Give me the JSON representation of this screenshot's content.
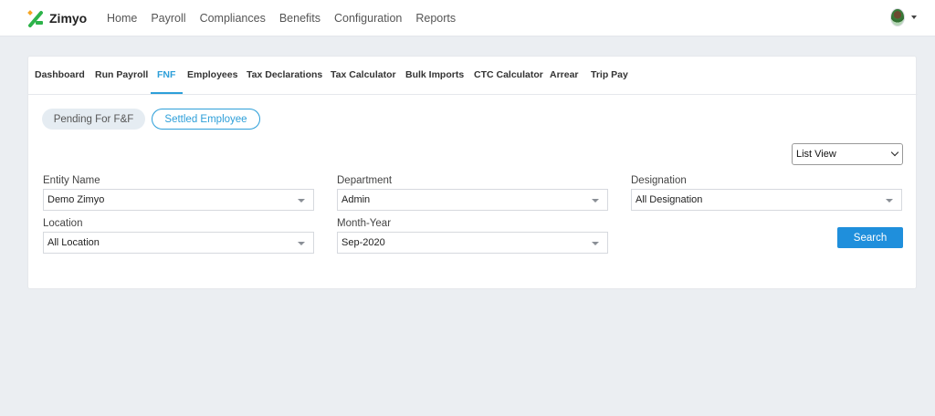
{
  "brand": {
    "name": "Zimyo",
    "accent": "#2d9fd9"
  },
  "nav": {
    "items": [
      "Home",
      "Payroll",
      "Compliances",
      "Benefits",
      "Configuration",
      "Reports"
    ]
  },
  "tabs": {
    "items": [
      "Dashboard",
      "Run Payroll",
      "FNF",
      "Employees",
      "Tax Declarations",
      "Tax Calculator",
      "Bulk Imports",
      "CTC Calculator",
      "Arrear",
      "Trip Pay"
    ],
    "active": "FNF"
  },
  "filters": {
    "pending_label": "Pending For F&F",
    "settled_label": "Settled Employee",
    "view_select": "List View"
  },
  "form": {
    "entity": {
      "label": "Entity Name",
      "value": "Demo Zimyo"
    },
    "department": {
      "label": "Department",
      "value": "Admin"
    },
    "designation": {
      "label": "Designation",
      "value": "All Designation"
    },
    "location": {
      "label": "Location",
      "value": "All Location"
    },
    "month_year": {
      "label": "Month-Year",
      "value": "Sep-2020"
    },
    "search_label": "Search"
  }
}
